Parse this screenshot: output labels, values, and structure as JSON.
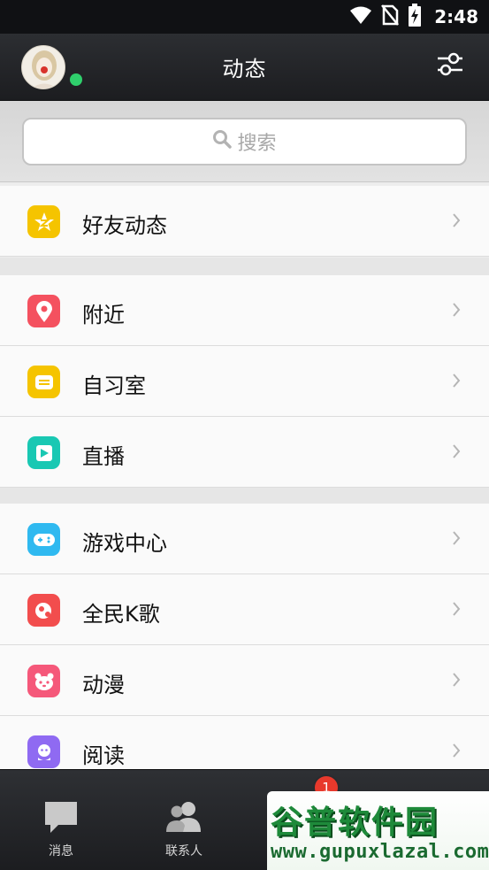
{
  "status_bar": {
    "time": "2:48",
    "icons": [
      "wifi-icon",
      "no-sim-icon",
      "battery-charging-icon"
    ]
  },
  "header": {
    "title": "动态",
    "online_color": "#2fcf6c"
  },
  "search": {
    "placeholder": "搜索"
  },
  "sections": [
    [
      {
        "label": "好友动态",
        "icon": "qzone-star-icon",
        "color": "#f5c400"
      }
    ],
    [
      {
        "label": "附近",
        "icon": "location-pin-icon",
        "color": "#f4515f"
      },
      {
        "label": "自习室",
        "icon": "study-room-icon",
        "color": "#f5c400"
      },
      {
        "label": "直播",
        "icon": "live-play-icon",
        "color": "#19c8b3"
      }
    ],
    [
      {
        "label": "游戏中心",
        "icon": "gamepad-icon",
        "color": "#2fb9f0"
      },
      {
        "label": "全民K歌",
        "icon": "karaoke-icon",
        "color": "#f24d4d"
      },
      {
        "label": "动漫",
        "icon": "panda-face-icon",
        "color": "#f5587a"
      },
      {
        "label": "阅读",
        "icon": "reading-icon",
        "color": "#8f6af2"
      }
    ]
  ],
  "bottom_nav": {
    "tabs": [
      {
        "label": "消息"
      },
      {
        "label": "联系人"
      }
    ],
    "badge_count": "1"
  },
  "watermark": {
    "title": "谷普软件园",
    "url": "www.gupuxlazal.com"
  }
}
